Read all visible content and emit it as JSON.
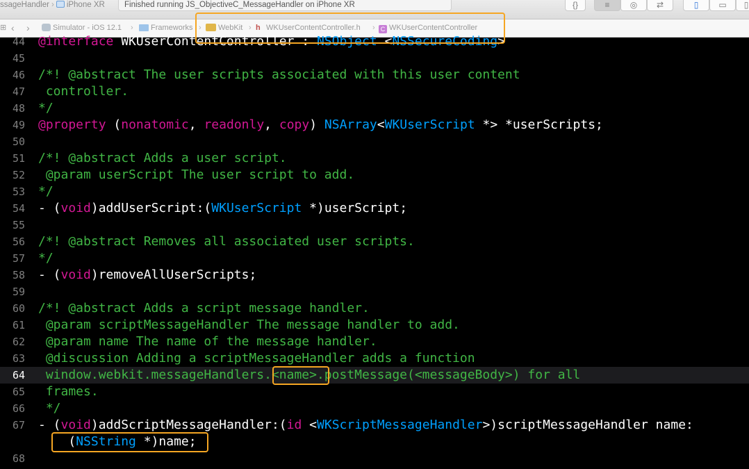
{
  "toolbar": {
    "scheme_target": "ssageHandler",
    "scheme_device": "iPhone XR",
    "status": "Finished running JS_ObjectiveC_MessageHandler on iPhone XR",
    "icons": [
      "curly-braces-icon",
      "standard-editor-icon",
      "assistant-editor-icon",
      "version-editor-icon",
      "navigator-panel-icon",
      "debug-panel-icon",
      "utilities-panel-icon"
    ]
  },
  "jumpbar": {
    "items": [
      {
        "label": "Simulator - iOS 12.1",
        "icon": "simulator-icon"
      },
      {
        "label": "Frameworks",
        "icon": "folder-icon"
      },
      {
        "label": "WebKit",
        "icon": "framework-icon"
      },
      {
        "label": "WKUserContentController.h",
        "icon": "header-file-icon"
      },
      {
        "label": "WKUserContentController",
        "icon": "class-icon"
      }
    ]
  },
  "editor": {
    "current_line": 64,
    "lines": [
      {
        "n": "44",
        "code": [
          [
            "k",
            "@interface"
          ],
          [
            "w",
            " WKUserContentController : "
          ],
          [
            "t",
            "NSObject"
          ],
          [
            "w",
            " <"
          ],
          [
            "t",
            "NSSecureCoding"
          ],
          [
            "w",
            ">"
          ]
        ]
      },
      {
        "n": "45",
        "code": []
      },
      {
        "n": "46",
        "code": [
          [
            "c",
            "/*! @abstract The user scripts associated with this user content"
          ]
        ]
      },
      {
        "n": "47",
        "code": [
          [
            "c",
            " controller."
          ]
        ]
      },
      {
        "n": "48",
        "code": [
          [
            "c",
            "*/"
          ]
        ]
      },
      {
        "n": "49",
        "code": [
          [
            "k",
            "@property"
          ],
          [
            "w",
            " ("
          ],
          [
            "k",
            "nonatomic"
          ],
          [
            "w",
            ", "
          ],
          [
            "k",
            "readonly"
          ],
          [
            "w",
            ", "
          ],
          [
            "k",
            "copy"
          ],
          [
            "w",
            ") "
          ],
          [
            "t",
            "NSArray"
          ],
          [
            "w",
            "<"
          ],
          [
            "t",
            "WKUserScript"
          ],
          [
            "w",
            " *> *userScripts;"
          ]
        ]
      },
      {
        "n": "50",
        "code": []
      },
      {
        "n": "51",
        "code": [
          [
            "c",
            "/*! @abstract Adds a user script."
          ]
        ]
      },
      {
        "n": "52",
        "code": [
          [
            "c",
            " @param userScript The user script to add."
          ]
        ]
      },
      {
        "n": "53",
        "code": [
          [
            "c",
            "*/"
          ]
        ]
      },
      {
        "n": "54",
        "code": [
          [
            "w",
            "- ("
          ],
          [
            "k",
            "void"
          ],
          [
            "w",
            ")addUserScript:("
          ],
          [
            "t",
            "WKUserScript"
          ],
          [
            "w",
            " *)userScript;"
          ]
        ]
      },
      {
        "n": "55",
        "code": []
      },
      {
        "n": "56",
        "code": [
          [
            "c",
            "/*! @abstract Removes all associated user scripts."
          ]
        ]
      },
      {
        "n": "57",
        "code": [
          [
            "c",
            "*/"
          ]
        ]
      },
      {
        "n": "58",
        "code": [
          [
            "w",
            "- ("
          ],
          [
            "k",
            "void"
          ],
          [
            "w",
            ")removeAllUserScripts;"
          ]
        ]
      },
      {
        "n": "59",
        "code": []
      },
      {
        "n": "60",
        "code": [
          [
            "c",
            "/*! @abstract Adds a script message handler."
          ]
        ]
      },
      {
        "n": "61",
        "code": [
          [
            "c",
            " @param scriptMessageHandler The message handler to add."
          ]
        ]
      },
      {
        "n": "62",
        "code": [
          [
            "c",
            " @param name The name of the message handler."
          ]
        ]
      },
      {
        "n": "63",
        "code": [
          [
            "c",
            " @discussion Adding a scriptMessageHandler adds a function"
          ]
        ]
      },
      {
        "n": "64",
        "code": [
          [
            "c",
            " window.webkit.messageHandlers.<name>.postMessage(<messageBody>) for all"
          ]
        ]
      },
      {
        "n": "65",
        "code": [
          [
            "c",
            " frames."
          ]
        ]
      },
      {
        "n": "66",
        "code": [
          [
            "c",
            " */"
          ]
        ]
      },
      {
        "n": "67",
        "code": [
          [
            "w",
            "- ("
          ],
          [
            "k",
            "void"
          ],
          [
            "w",
            ")addScriptMessageHandler:("
          ],
          [
            "k",
            "id"
          ],
          [
            "w",
            " <"
          ],
          [
            "t",
            "WKScriptMessageHandler"
          ],
          [
            "w",
            ">)scriptMessageHandler name:"
          ]
        ]
      },
      {
        "n": "",
        "code": [
          [
            "w",
            "    ("
          ],
          [
            "t",
            "NSString"
          ],
          [
            "w",
            " *)name;"
          ]
        ]
      },
      {
        "n": "68",
        "code": []
      }
    ]
  },
  "colors": {
    "comment": "#41b645",
    "keyword": "#d31895",
    "type": "#00a0ff",
    "plain": "#ffffff",
    "highlight_box": "#f5a623"
  }
}
